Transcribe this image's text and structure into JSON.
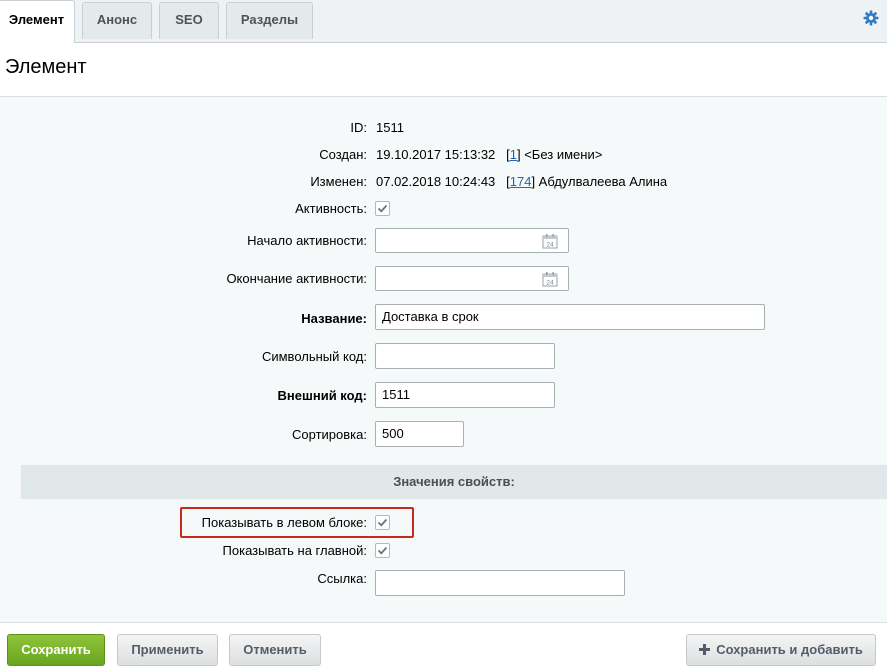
{
  "tabs": [
    {
      "label": "Элемент",
      "active": true
    },
    {
      "label": "Анонс",
      "active": false
    },
    {
      "label": "SEO",
      "active": false
    },
    {
      "label": "Разделы",
      "active": false
    }
  ],
  "settings_icon": "gear-icon",
  "page_title": "Элемент",
  "fields": {
    "id": {
      "label": "ID:",
      "value": "1511"
    },
    "created": {
      "label": "Создан:",
      "date": "19.10.2017 15:13:32",
      "user_id": "1",
      "user_name": "<Без имени>"
    },
    "modified": {
      "label": "Изменен:",
      "date": "07.02.2018 10:24:43",
      "user_id": "174",
      "user_name": "Абдулвалеева Алина"
    },
    "active": {
      "label": "Активность:",
      "checked": true
    },
    "active_from": {
      "label": "Начало активности:",
      "value": ""
    },
    "active_to": {
      "label": "Окончание активности:",
      "value": ""
    },
    "name": {
      "label": "Название:",
      "value": "Доставка в срок"
    },
    "code": {
      "label": "Символьный код:",
      "value": ""
    },
    "xml_id": {
      "label": "Внешний код:",
      "value": "1511"
    },
    "sort": {
      "label": "Сортировка:",
      "value": "500"
    }
  },
  "calendar_icon": {
    "name": "calendar-icon",
    "day": "24"
  },
  "properties": {
    "title": "Значения свойств:",
    "show_left": {
      "label": "Показывать в левом блоке:",
      "checked": true
    },
    "show_main": {
      "label": "Показывать на главной:",
      "checked": true
    },
    "link": {
      "label": "Ссылка:",
      "value": ""
    }
  },
  "buttons": {
    "save": "Сохранить",
    "apply": "Применить",
    "cancel": "Отменить",
    "save_add": "Сохранить и добавить"
  },
  "colors": {
    "accent_green": "#7bb52a",
    "highlight_red": "#c42b1c",
    "link_blue": "#2067b0"
  }
}
